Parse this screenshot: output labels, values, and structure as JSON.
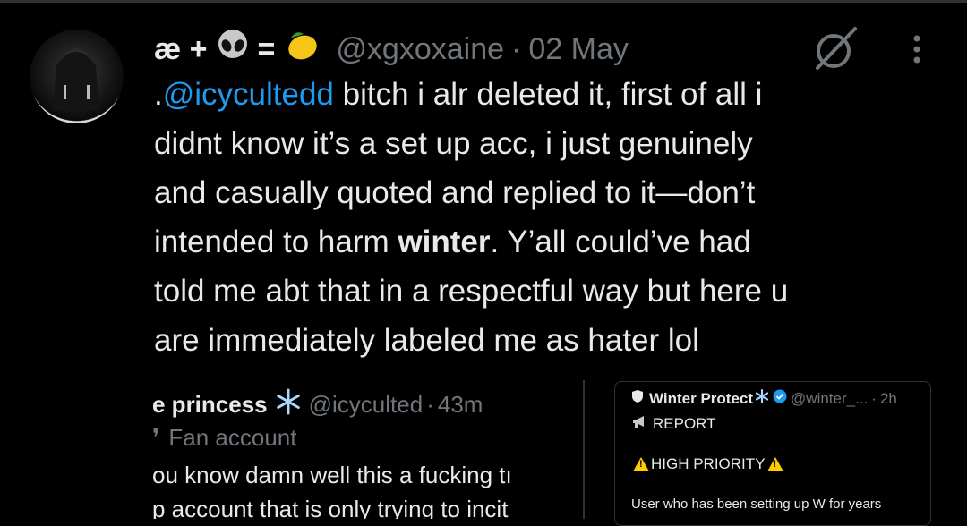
{
  "tweet": {
    "author": {
      "name_part1": "æ +",
      "name_eq": "=",
      "handle": "@xgxoxaine",
      "separator": "·",
      "date": "02 May"
    },
    "text": {
      "line1_prefix": ".",
      "line1_mention": "@icycultedd",
      "line1_rest": " bitch i alr deleted it, first of all i",
      "line2": "didnt know it’s a set up acc, i just genuinely",
      "line3": "and casually quoted and replied to it—don’t",
      "line4_pre": "intended to harm ",
      "line4_bold": "winter",
      "line4_post": ". Y’all could’ve had",
      "line5": "told me abt that in a respectful way but here u",
      "line6": "are immediately labeled me as hater lol"
    }
  },
  "media_left": {
    "name": "e princess",
    "handle": "@icyculted",
    "separator": "·",
    "time": "43m",
    "label": "Fan account",
    "body_line1": "ou know damn well this a fucking tı",
    "body_line2": "p account that is only trying to incit"
  },
  "media_right": {
    "name": "Winter Protect",
    "handle": "@winter_...",
    "separator": "·",
    "time": "2h",
    "report": "REPORT",
    "priority": "HIGH PRIORITY",
    "body_line1": "User who has been setting up W for years"
  },
  "icons": [
    "grok-icon",
    "more-vertical-icon",
    "alien-emoji",
    "lemon-emoji",
    "snowflake-icon",
    "verified-badge-icon",
    "megaphone-icon",
    "warning-icon"
  ],
  "colors": {
    "background": "#000000",
    "text": "#e7e9ea",
    "muted": "#71767b",
    "link": "#1d9bf0"
  }
}
